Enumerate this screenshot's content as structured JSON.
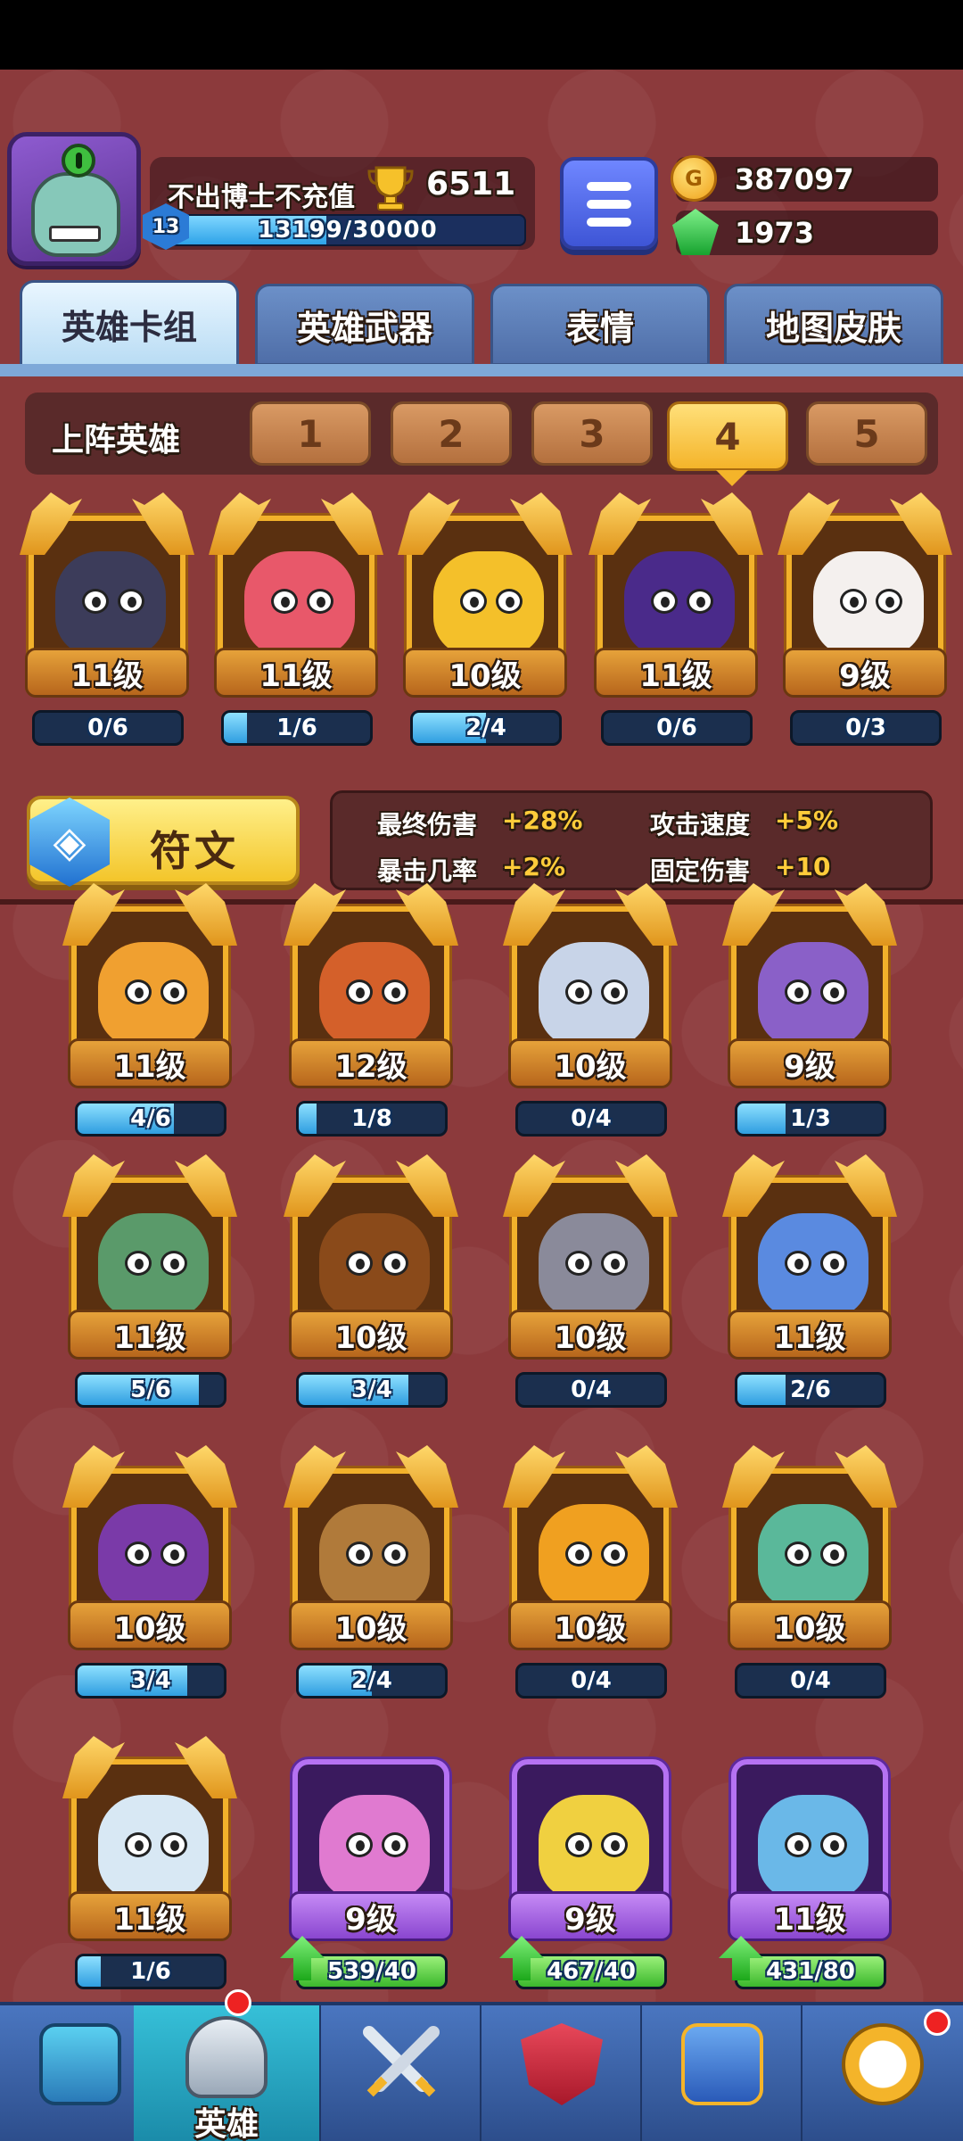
{
  "player": {
    "name": "不出博士不充值",
    "trophies": "6511",
    "level": "13",
    "xp_text": "13199/30000",
    "xp_fraction": 0.44
  },
  "currency": {
    "gold": "387097",
    "gems": "1973"
  },
  "tabs": [
    "英雄卡组",
    "英雄武器",
    "表情",
    "地图皮肤"
  ],
  "deck": {
    "label": "上阵英雄",
    "slots": [
      "1",
      "2",
      "3",
      "4",
      "5"
    ],
    "active_slot": 4
  },
  "deck_heroes": [
    {
      "level": "11级",
      "progress": "0/6",
      "fraction": 0,
      "color": "#3c3c5a"
    },
    {
      "level": "11级",
      "progress": "1/6",
      "fraction": 0.16,
      "color": "#e8586a"
    },
    {
      "level": "10级",
      "progress": "2/4",
      "fraction": 0.5,
      "color": "#f4c02a"
    },
    {
      "level": "11级",
      "progress": "0/6",
      "fraction": 0,
      "color": "#4a2a8a"
    },
    {
      "level": "9级",
      "progress": "0/3",
      "fraction": 0,
      "color": "#f4f0ee"
    }
  ],
  "rune": {
    "label": "符文"
  },
  "stats": [
    {
      "name": "最终伤害",
      "value": "+28%"
    },
    {
      "name": "攻击速度",
      "value": "+5%"
    },
    {
      "name": "暴击几率",
      "value": "+2%"
    },
    {
      "name": "固定伤害",
      "value": "+10"
    }
  ],
  "collection": [
    {
      "level": "11级",
      "progress": "4/6",
      "fraction": 0.66,
      "color": "#f0a030",
      "rarity": "legend"
    },
    {
      "level": "12级",
      "progress": "1/8",
      "fraction": 0.12,
      "color": "#d4602a",
      "rarity": "legend"
    },
    {
      "level": "10级",
      "progress": "0/4",
      "fraction": 0,
      "color": "#c8d4e8",
      "rarity": "legend"
    },
    {
      "level": "9级",
      "progress": "1/3",
      "fraction": 0.33,
      "color": "#8a60c8",
      "rarity": "legend"
    },
    {
      "level": "11级",
      "progress": "5/6",
      "fraction": 0.83,
      "color": "#5a9a6a",
      "rarity": "legend"
    },
    {
      "level": "10级",
      "progress": "3/4",
      "fraction": 0.75,
      "color": "#8a4a1a",
      "rarity": "legend"
    },
    {
      "level": "10级",
      "progress": "0/4",
      "fraction": 0,
      "color": "#8a8a9a",
      "rarity": "legend"
    },
    {
      "level": "11级",
      "progress": "2/6",
      "fraction": 0.33,
      "color": "#5a8ae0",
      "rarity": "legend"
    },
    {
      "level": "10级",
      "progress": "3/4",
      "fraction": 0.75,
      "color": "#7a3aa8",
      "rarity": "legend"
    },
    {
      "level": "10级",
      "progress": "2/4",
      "fraction": 0.5,
      "color": "#b07a3a",
      "rarity": "legend"
    },
    {
      "level": "10级",
      "progress": "0/4",
      "fraction": 0,
      "color": "#f0a020",
      "rarity": "legend"
    },
    {
      "level": "10级",
      "progress": "0/4",
      "fraction": 0,
      "color": "#5ab89a",
      "rarity": "legend"
    },
    {
      "level": "11级",
      "progress": "1/6",
      "fraction": 0.16,
      "color": "#d8e8f4",
      "rarity": "legend"
    },
    {
      "level": "9级",
      "progress": "539/40",
      "fraction": 1,
      "color": "#e07ad0",
      "rarity": "epic",
      "upgrade": true
    },
    {
      "level": "9级",
      "progress": "467/40",
      "fraction": 1,
      "color": "#f0d040",
      "rarity": "epic",
      "upgrade": true
    },
    {
      "level": "11级",
      "progress": "431/80",
      "fraction": 1,
      "color": "#6ab8e8",
      "rarity": "epic",
      "upgrade": true
    }
  ],
  "nav": {
    "items": [
      {
        "name": "shop",
        "label": "",
        "icon": "treasure-chest-icon"
      },
      {
        "name": "heroes",
        "label": "英雄",
        "icon": "knight-helmet-icon"
      },
      {
        "name": "battle",
        "label": "",
        "icon": "crossed-swords-icon"
      },
      {
        "name": "clan",
        "label": "",
        "icon": "crown-shield-icon"
      },
      {
        "name": "social",
        "label": "",
        "icon": "friends-icon"
      },
      {
        "name": "events",
        "label": "",
        "icon": "compass-icon"
      }
    ]
  },
  "colors": {
    "background": "#8c3a3c",
    "accent_gold": "#f4b42a",
    "tab_blue": "#4f6ea8"
  }
}
